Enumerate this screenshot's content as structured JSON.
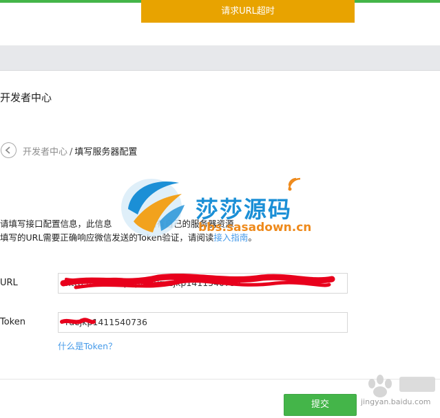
{
  "toast": {
    "text": "请求URL超时"
  },
  "page": {
    "title": "开发者中心",
    "breadcrumb": {
      "parent": "开发者中心",
      "separator": "/",
      "current": "填写服务器配置"
    }
  },
  "watermark": {
    "name": "莎莎源码",
    "url": "bbs.sasadown.cn"
  },
  "description": {
    "line1": "请填写接口配置信息，此信息",
    "line1_tail": "拥有自己的服务器资源",
    "line2_prefix": "填写的URL需要正确响应微信发送的Token验证，请阅读",
    "line2_link": "接入指南",
    "line2_suffix": "。"
  },
  "form": {
    "url": {
      "label": "URL",
      "value": "http://                    /index.php/api/ruejkp1411540736"
    },
    "token": {
      "label": "Token",
      "value": "ruejkp1411540736",
      "help_link": "什么是Token？"
    }
  },
  "actions": {
    "submit_label": "提交"
  },
  "corner_watermark": {
    "text": "jingyan.baidu.com"
  },
  "colors": {
    "accent_green": "#44b549",
    "toast_orange": "#e8a300",
    "link_blue": "#459ae9",
    "redaction_red": "#e8001c"
  }
}
